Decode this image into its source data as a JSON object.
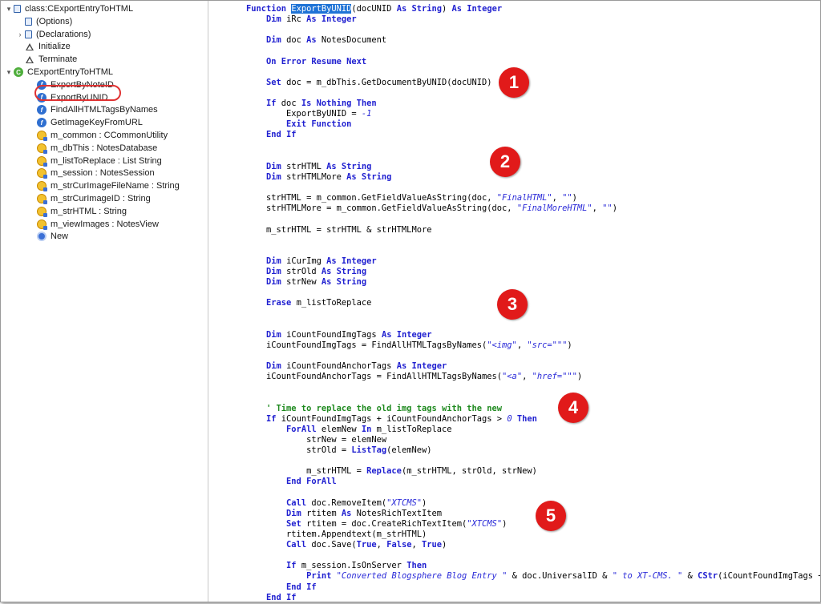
{
  "tree": {
    "items": [
      {
        "label": "class:CExportEntryToHTML",
        "icon": "script-icon",
        "twisty": "▾"
      },
      {
        "label": "(Options)",
        "icon": "script-icon",
        "twisty": ""
      },
      {
        "label": "(Declarations)",
        "icon": "script-icon",
        "twisty": "›"
      },
      {
        "label": "Initialize",
        "icon": "triangle-icon",
        "twisty": ""
      },
      {
        "label": "Terminate",
        "icon": "triangle-icon",
        "twisty": ""
      },
      {
        "label": "CExportEntryToHTML",
        "icon": "class-icon",
        "twisty": "▾"
      },
      {
        "label": "ExportByNoteID",
        "icon": "function-icon",
        "twisty": ""
      },
      {
        "label": "ExportByUNID",
        "icon": "function-icon",
        "twisty": ""
      },
      {
        "label": "FindAllHTMLTagsByNames",
        "icon": "function-icon",
        "twisty": ""
      },
      {
        "label": "GetImageKeyFromURL",
        "icon": "function-icon",
        "twisty": ""
      },
      {
        "label": "m_common : CCommonUtility",
        "icon": "property-icon",
        "twisty": ""
      },
      {
        "label": "m_dbThis : NotesDatabase",
        "icon": "property-icon",
        "twisty": ""
      },
      {
        "label": "m_listToReplace : List String",
        "icon": "property-icon",
        "twisty": ""
      },
      {
        "label": "m_session : NotesSession",
        "icon": "property-icon",
        "twisty": ""
      },
      {
        "label": "m_strCurImageFileName : String",
        "icon": "property-icon",
        "twisty": ""
      },
      {
        "label": "m_strCurImageID : String",
        "icon": "property-icon",
        "twisty": ""
      },
      {
        "label": "m_strHTML : String",
        "icon": "property-icon",
        "twisty": ""
      },
      {
        "label": "m_viewImages : NotesView",
        "icon": "property-icon",
        "twisty": ""
      },
      {
        "label": "New",
        "icon": "constructor-icon",
        "twisty": ""
      }
    ],
    "selected": "ExportByUNID"
  },
  "markers": [
    "1",
    "2",
    "3",
    "4",
    "5"
  ],
  "colors": {
    "keyword": "#1f1fd0",
    "string": "#2a2ad8",
    "comment": "#1f8a1f",
    "marker": "#e11a1a",
    "selection": "#1e73d6"
  },
  "code": {
    "lines": [
      [
        {
          "t": "Function ",
          "c": "kw"
        },
        {
          "t": "ExportByUNID",
          "c": "hl"
        },
        {
          "t": "(docUNID "
        },
        {
          "t": "As String",
          "c": "kw"
        },
        {
          "t": ") "
        },
        {
          "t": "As Integer",
          "c": "kw"
        }
      ],
      [
        {
          "t": "    "
        },
        {
          "t": "Dim",
          "c": "kw"
        },
        {
          "t": " iRc "
        },
        {
          "t": "As Integer",
          "c": "kw"
        }
      ],
      [],
      [
        {
          "t": "    "
        },
        {
          "t": "Dim",
          "c": "kw"
        },
        {
          "t": " doc "
        },
        {
          "t": "As",
          "c": "kw"
        },
        {
          "t": " NotesDocument"
        }
      ],
      [],
      [
        {
          "t": "    "
        },
        {
          "t": "On Error Resume Next",
          "c": "kw"
        }
      ],
      [],
      [
        {
          "t": "    "
        },
        {
          "t": "Set",
          "c": "kw"
        },
        {
          "t": " doc = m_dbThis.GetDocumentByUNID(docUNID)"
        }
      ],
      [],
      [
        {
          "t": "    "
        },
        {
          "t": "If",
          "c": "kw"
        },
        {
          "t": " doc "
        },
        {
          "t": "Is Nothing Then",
          "c": "kw"
        }
      ],
      [
        {
          "t": "        ExportByUNID = "
        },
        {
          "t": "-1",
          "c": "st"
        }
      ],
      [
        {
          "t": "        "
        },
        {
          "t": "Exit Function",
          "c": "kw"
        }
      ],
      [
        {
          "t": "    "
        },
        {
          "t": "End If",
          "c": "kw"
        }
      ],
      [],
      [],
      [
        {
          "t": "    "
        },
        {
          "t": "Dim",
          "c": "kw"
        },
        {
          "t": " strHTML "
        },
        {
          "t": "As String",
          "c": "kw"
        }
      ],
      [
        {
          "t": "    "
        },
        {
          "t": "Dim",
          "c": "kw"
        },
        {
          "t": " strHTMLMore "
        },
        {
          "t": "As String",
          "c": "kw"
        }
      ],
      [],
      [
        {
          "t": "    strHTML = m_common.GetFieldValueAsString(doc, "
        },
        {
          "t": "\"FinalHTML\"",
          "c": "st"
        },
        {
          "t": ", "
        },
        {
          "t": "\"\"",
          "c": "st"
        },
        {
          "t": ")"
        }
      ],
      [
        {
          "t": "    strHTMLMore = m_common.GetFieldValueAsString(doc, "
        },
        {
          "t": "\"FinalMoreHTML\"",
          "c": "st"
        },
        {
          "t": ", "
        },
        {
          "t": "\"\"",
          "c": "st"
        },
        {
          "t": ")"
        }
      ],
      [],
      [
        {
          "t": "    m_strHTML = strHTML & strHTMLMore"
        }
      ],
      [],
      [],
      [
        {
          "t": "    "
        },
        {
          "t": "Dim",
          "c": "kw"
        },
        {
          "t": " iCurImg "
        },
        {
          "t": "As Integer",
          "c": "kw"
        }
      ],
      [
        {
          "t": "    "
        },
        {
          "t": "Dim",
          "c": "kw"
        },
        {
          "t": " strOld "
        },
        {
          "t": "As String",
          "c": "kw"
        }
      ],
      [
        {
          "t": "    "
        },
        {
          "t": "Dim",
          "c": "kw"
        },
        {
          "t": " strNew "
        },
        {
          "t": "As String",
          "c": "kw"
        }
      ],
      [],
      [
        {
          "t": "    "
        },
        {
          "t": "Erase",
          "c": "kw"
        },
        {
          "t": " m_listToReplace"
        }
      ],
      [],
      [],
      [
        {
          "t": "    "
        },
        {
          "t": "Dim",
          "c": "kw"
        },
        {
          "t": " iCountFoundImgTags "
        },
        {
          "t": "As Integer",
          "c": "kw"
        }
      ],
      [
        {
          "t": "    iCountFoundImgTags = FindAllHTMLTagsByNames("
        },
        {
          "t": "\"<img\"",
          "c": "st"
        },
        {
          "t": ", "
        },
        {
          "t": "\"src=\"\"\"",
          "c": "st"
        },
        {
          "t": ")"
        }
      ],
      [],
      [
        {
          "t": "    "
        },
        {
          "t": "Dim",
          "c": "kw"
        },
        {
          "t": " iCountFoundAnchorTags "
        },
        {
          "t": "As Integer",
          "c": "kw"
        }
      ],
      [
        {
          "t": "    iCountFoundAnchorTags = FindAllHTMLTagsByNames("
        },
        {
          "t": "\"<a\"",
          "c": "st"
        },
        {
          "t": ", "
        },
        {
          "t": "\"href=\"\"\"",
          "c": "st"
        },
        {
          "t": ")"
        }
      ],
      [],
      [],
      [
        {
          "t": "    ' Time to replace the old img tags with the new",
          "c": "cm"
        }
      ],
      [
        {
          "t": "    "
        },
        {
          "t": "If",
          "c": "kw"
        },
        {
          "t": " iCountFoundImgTags + iCountFoundAnchorTags > "
        },
        {
          "t": "0",
          "c": "st"
        },
        {
          "t": " "
        },
        {
          "t": "Then",
          "c": "kw"
        }
      ],
      [
        {
          "t": "        "
        },
        {
          "t": "ForAll",
          "c": "kw"
        },
        {
          "t": " elemNew "
        },
        {
          "t": "In",
          "c": "kw"
        },
        {
          "t": " m_listToReplace"
        }
      ],
      [
        {
          "t": "            strNew = elemNew"
        }
      ],
      [
        {
          "t": "            strOld = "
        },
        {
          "t": "ListTag",
          "c": "kw"
        },
        {
          "t": "(elemNew)"
        }
      ],
      [],
      [
        {
          "t": "            m_strHTML = "
        },
        {
          "t": "Replace",
          "c": "kw"
        },
        {
          "t": "(m_strHTML, strOld, strNew)"
        }
      ],
      [
        {
          "t": "        "
        },
        {
          "t": "End ForAll",
          "c": "kw"
        }
      ],
      [],
      [
        {
          "t": "        "
        },
        {
          "t": "Call",
          "c": "kw"
        },
        {
          "t": " doc.RemoveItem("
        },
        {
          "t": "\"XTCMS\"",
          "c": "st"
        },
        {
          "t": ")"
        }
      ],
      [
        {
          "t": "        "
        },
        {
          "t": "Dim",
          "c": "kw"
        },
        {
          "t": " rtitem "
        },
        {
          "t": "As",
          "c": "kw"
        },
        {
          "t": " NotesRichTextItem"
        }
      ],
      [
        {
          "t": "        "
        },
        {
          "t": "Set",
          "c": "kw"
        },
        {
          "t": " rtitem = doc.CreateRichTextItem("
        },
        {
          "t": "\"XTCMS\"",
          "c": "st"
        },
        {
          "t": ")"
        }
      ],
      [
        {
          "t": "        rtitem.Appendtext(m_strHTML)"
        }
      ],
      [
        {
          "t": "        "
        },
        {
          "t": "Call",
          "c": "kw"
        },
        {
          "t": " doc.Save("
        },
        {
          "t": "True",
          "c": "kw"
        },
        {
          "t": ", "
        },
        {
          "t": "False",
          "c": "kw"
        },
        {
          "t": ", "
        },
        {
          "t": "True",
          "c": "kw"
        },
        {
          "t": ")"
        }
      ],
      [],
      [
        {
          "t": "        "
        },
        {
          "t": "If",
          "c": "kw"
        },
        {
          "t": " m_session.IsOnServer "
        },
        {
          "t": "Then",
          "c": "kw"
        }
      ],
      [
        {
          "t": "            "
        },
        {
          "t": "Print",
          "c": "kw"
        },
        {
          "t": " "
        },
        {
          "t": "\"Converted Blogsphere Blog Entry \"",
          "c": "st"
        },
        {
          "t": " & doc.UniversalID & "
        },
        {
          "t": "\" to XT-CMS. \"",
          "c": "st"
        },
        {
          "t": " & "
        },
        {
          "t": "CStr",
          "c": "kw"
        },
        {
          "t": "(iCountFoundImgTags + i"
        }
      ],
      [
        {
          "t": "        "
        },
        {
          "t": "End If",
          "c": "kw"
        }
      ],
      [
        {
          "t": "    "
        },
        {
          "t": "End If",
          "c": "kw"
        }
      ]
    ]
  }
}
